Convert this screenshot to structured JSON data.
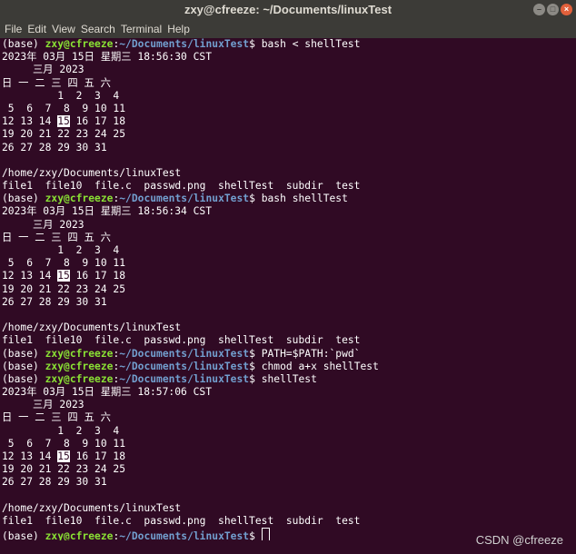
{
  "window": {
    "title": "zxy@cfreeze: ~/Documents/linuxTest",
    "buttons": [
      "–",
      "□",
      "×"
    ]
  },
  "menu": [
    "File",
    "Edit",
    "View",
    "Search",
    "Terminal",
    "Help"
  ],
  "prompt": {
    "env": "(base) ",
    "user": "zxy@cfreeze",
    "sep": ":",
    "path": "~/Documents/linuxTest",
    "sym": "$ "
  },
  "terminal": {
    "lines": [
      {
        "type": "prompt",
        "cmd": "bash < shellTest"
      },
      {
        "type": "text",
        "text": "2023年 03月 15日 星期三 18:56:30 CST"
      },
      {
        "type": "text",
        "text": "     三月 2023"
      },
      {
        "type": "text",
        "text": "日 一 二 三 四 五 六"
      },
      {
        "type": "text",
        "text": "         1  2  3  4"
      },
      {
        "type": "text",
        "text": " 5  6  7  8  9 10 11"
      },
      {
        "type": "cal",
        "pre": "12 13 14 ",
        "hl": "15",
        "post": " 16 17 18"
      },
      {
        "type": "text",
        "text": "19 20 21 22 23 24 25"
      },
      {
        "type": "text",
        "text": "26 27 28 29 30 31"
      },
      {
        "type": "text",
        "text": ""
      },
      {
        "type": "text",
        "text": "/home/zxy/Documents/linuxTest"
      },
      {
        "type": "text",
        "text": "file1  file10  file.c  passwd.png  shellTest  subdir  test"
      },
      {
        "type": "prompt",
        "cmd": "bash shellTest"
      },
      {
        "type": "text",
        "text": "2023年 03月 15日 星期三 18:56:34 CST"
      },
      {
        "type": "text",
        "text": "     三月 2023"
      },
      {
        "type": "text",
        "text": "日 一 二 三 四 五 六"
      },
      {
        "type": "text",
        "text": "         1  2  3  4"
      },
      {
        "type": "text",
        "text": " 5  6  7  8  9 10 11"
      },
      {
        "type": "cal",
        "pre": "12 13 14 ",
        "hl": "15",
        "post": " 16 17 18"
      },
      {
        "type": "text",
        "text": "19 20 21 22 23 24 25"
      },
      {
        "type": "text",
        "text": "26 27 28 29 30 31"
      },
      {
        "type": "text",
        "text": ""
      },
      {
        "type": "text",
        "text": "/home/zxy/Documents/linuxTest"
      },
      {
        "type": "text",
        "text": "file1  file10  file.c  passwd.png  shellTest  subdir  test"
      },
      {
        "type": "prompt",
        "cmd": "PATH=$PATH:`pwd`"
      },
      {
        "type": "prompt",
        "cmd": "chmod a+x shellTest"
      },
      {
        "type": "prompt",
        "cmd": "shellTest"
      },
      {
        "type": "text",
        "text": "2023年 03月 15日 星期三 18:57:06 CST"
      },
      {
        "type": "text",
        "text": "     三月 2023"
      },
      {
        "type": "text",
        "text": "日 一 二 三 四 五 六"
      },
      {
        "type": "text",
        "text": "         1  2  3  4"
      },
      {
        "type": "text",
        "text": " 5  6  7  8  9 10 11"
      },
      {
        "type": "cal",
        "pre": "12 13 14 ",
        "hl": "15",
        "post": " 16 17 18"
      },
      {
        "type": "text",
        "text": "19 20 21 22 23 24 25"
      },
      {
        "type": "text",
        "text": "26 27 28 29 30 31"
      },
      {
        "type": "text",
        "text": ""
      },
      {
        "type": "text",
        "text": "/home/zxy/Documents/linuxTest"
      },
      {
        "type": "text",
        "text": "file1  file10  file.c  passwd.png  shellTest  subdir  test"
      },
      {
        "type": "prompt",
        "cmd": "",
        "cursor": true
      }
    ]
  },
  "watermark": "CSDN @cfreeze"
}
